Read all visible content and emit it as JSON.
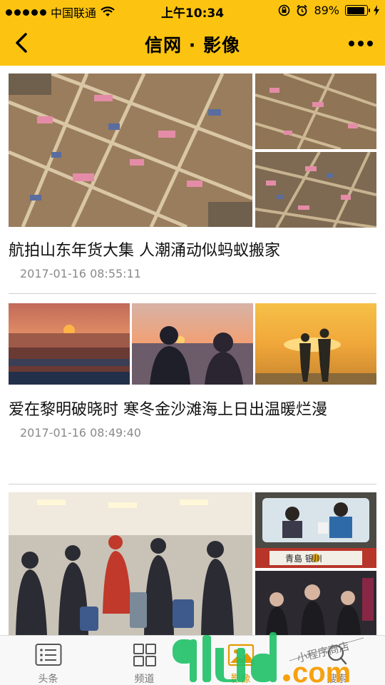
{
  "status_bar": {
    "carrier": "中国联通",
    "time": "上午10:34",
    "battery_text": "89%",
    "battery_level": 0.89,
    "icons": [
      "signal-dots-icon",
      "wifi-icon",
      "rotation-lock-icon",
      "alarm-icon",
      "battery-icon",
      "charging-icon"
    ]
  },
  "navbar": {
    "title": "信网 · 影像",
    "back_icon": "chevron-left-icon",
    "more_icon": "more-dots-icon",
    "background": "#fcc411"
  },
  "articles": [
    {
      "title": "航拍山东年货大集 人潮涌动似蚂蚁搬家",
      "time": "2017-01-16 08:55:11",
      "images": [
        "aerial-market-photo",
        "aerial-market-photo",
        "aerial-market-photo"
      ]
    },
    {
      "title": "爱在黎明破晓时 寒冬金沙滩海上日出温暖烂漫",
      "time": "2017-01-16 08:49:40",
      "images": [
        "sunrise-sea-photo",
        "couple-silhouette-photo",
        "couple-beach-photo"
      ]
    },
    {
      "title": "",
      "time": "",
      "images": [
        "railway-station-crowd-photo",
        "train-window-photo",
        "crowd-photo"
      ],
      "sign_text": "青島 银川"
    }
  ],
  "tabbar": {
    "active_color": "#e39a00",
    "items": [
      {
        "label": "头条",
        "icon": "news-list-icon",
        "active": false
      },
      {
        "label": "频道",
        "icon": "grid-icon",
        "active": false
      },
      {
        "label": "影像",
        "icon": "image-icon",
        "active": true
      },
      {
        "label": "搜索",
        "icon": "search-icon",
        "active": false
      }
    ]
  },
  "watermark": {
    "text": "91ud.com",
    "subtitle": "小程序商店"
  }
}
